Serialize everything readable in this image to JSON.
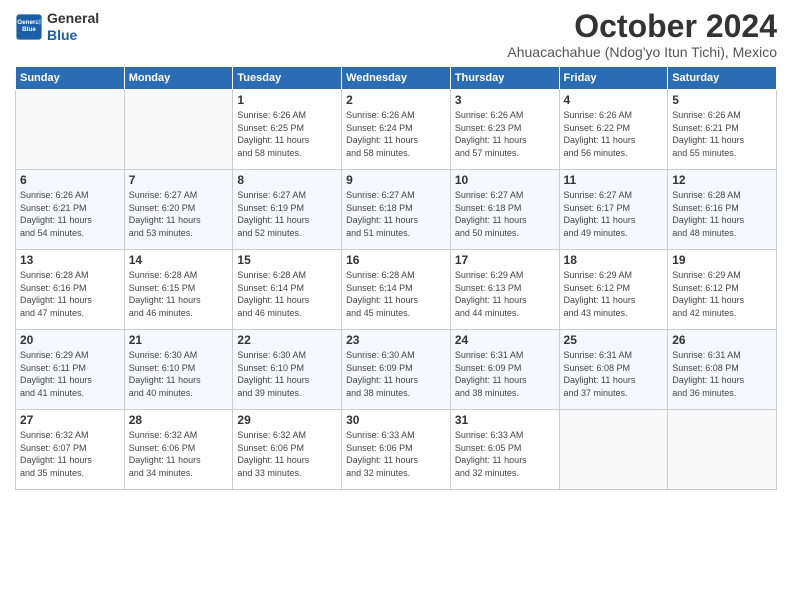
{
  "logo": {
    "line1": "General",
    "line2": "Blue"
  },
  "title": "October 2024",
  "location": "Ahuacachahue (Ndog'yo Itun Tichi), Mexico",
  "days_of_week": [
    "Sunday",
    "Monday",
    "Tuesday",
    "Wednesday",
    "Thursday",
    "Friday",
    "Saturday"
  ],
  "weeks": [
    [
      {
        "day": "",
        "info": ""
      },
      {
        "day": "",
        "info": ""
      },
      {
        "day": "1",
        "info": "Sunrise: 6:26 AM\nSunset: 6:25 PM\nDaylight: 11 hours\nand 58 minutes."
      },
      {
        "day": "2",
        "info": "Sunrise: 6:26 AM\nSunset: 6:24 PM\nDaylight: 11 hours\nand 58 minutes."
      },
      {
        "day": "3",
        "info": "Sunrise: 6:26 AM\nSunset: 6:23 PM\nDaylight: 11 hours\nand 57 minutes."
      },
      {
        "day": "4",
        "info": "Sunrise: 6:26 AM\nSunset: 6:22 PM\nDaylight: 11 hours\nand 56 minutes."
      },
      {
        "day": "5",
        "info": "Sunrise: 6:26 AM\nSunset: 6:21 PM\nDaylight: 11 hours\nand 55 minutes."
      }
    ],
    [
      {
        "day": "6",
        "info": "Sunrise: 6:26 AM\nSunset: 6:21 PM\nDaylight: 11 hours\nand 54 minutes."
      },
      {
        "day": "7",
        "info": "Sunrise: 6:27 AM\nSunset: 6:20 PM\nDaylight: 11 hours\nand 53 minutes."
      },
      {
        "day": "8",
        "info": "Sunrise: 6:27 AM\nSunset: 6:19 PM\nDaylight: 11 hours\nand 52 minutes."
      },
      {
        "day": "9",
        "info": "Sunrise: 6:27 AM\nSunset: 6:18 PM\nDaylight: 11 hours\nand 51 minutes."
      },
      {
        "day": "10",
        "info": "Sunrise: 6:27 AM\nSunset: 6:18 PM\nDaylight: 11 hours\nand 50 minutes."
      },
      {
        "day": "11",
        "info": "Sunrise: 6:27 AM\nSunset: 6:17 PM\nDaylight: 11 hours\nand 49 minutes."
      },
      {
        "day": "12",
        "info": "Sunrise: 6:28 AM\nSunset: 6:16 PM\nDaylight: 11 hours\nand 48 minutes."
      }
    ],
    [
      {
        "day": "13",
        "info": "Sunrise: 6:28 AM\nSunset: 6:16 PM\nDaylight: 11 hours\nand 47 minutes."
      },
      {
        "day": "14",
        "info": "Sunrise: 6:28 AM\nSunset: 6:15 PM\nDaylight: 11 hours\nand 46 minutes."
      },
      {
        "day": "15",
        "info": "Sunrise: 6:28 AM\nSunset: 6:14 PM\nDaylight: 11 hours\nand 46 minutes."
      },
      {
        "day": "16",
        "info": "Sunrise: 6:28 AM\nSunset: 6:14 PM\nDaylight: 11 hours\nand 45 minutes."
      },
      {
        "day": "17",
        "info": "Sunrise: 6:29 AM\nSunset: 6:13 PM\nDaylight: 11 hours\nand 44 minutes."
      },
      {
        "day": "18",
        "info": "Sunrise: 6:29 AM\nSunset: 6:12 PM\nDaylight: 11 hours\nand 43 minutes."
      },
      {
        "day": "19",
        "info": "Sunrise: 6:29 AM\nSunset: 6:12 PM\nDaylight: 11 hours\nand 42 minutes."
      }
    ],
    [
      {
        "day": "20",
        "info": "Sunrise: 6:29 AM\nSunset: 6:11 PM\nDaylight: 11 hours\nand 41 minutes."
      },
      {
        "day": "21",
        "info": "Sunrise: 6:30 AM\nSunset: 6:10 PM\nDaylight: 11 hours\nand 40 minutes."
      },
      {
        "day": "22",
        "info": "Sunrise: 6:30 AM\nSunset: 6:10 PM\nDaylight: 11 hours\nand 39 minutes."
      },
      {
        "day": "23",
        "info": "Sunrise: 6:30 AM\nSunset: 6:09 PM\nDaylight: 11 hours\nand 38 minutes."
      },
      {
        "day": "24",
        "info": "Sunrise: 6:31 AM\nSunset: 6:09 PM\nDaylight: 11 hours\nand 38 minutes."
      },
      {
        "day": "25",
        "info": "Sunrise: 6:31 AM\nSunset: 6:08 PM\nDaylight: 11 hours\nand 37 minutes."
      },
      {
        "day": "26",
        "info": "Sunrise: 6:31 AM\nSunset: 6:08 PM\nDaylight: 11 hours\nand 36 minutes."
      }
    ],
    [
      {
        "day": "27",
        "info": "Sunrise: 6:32 AM\nSunset: 6:07 PM\nDaylight: 11 hours\nand 35 minutes."
      },
      {
        "day": "28",
        "info": "Sunrise: 6:32 AM\nSunset: 6:06 PM\nDaylight: 11 hours\nand 34 minutes."
      },
      {
        "day": "29",
        "info": "Sunrise: 6:32 AM\nSunset: 6:06 PM\nDaylight: 11 hours\nand 33 minutes."
      },
      {
        "day": "30",
        "info": "Sunrise: 6:33 AM\nSunset: 6:06 PM\nDaylight: 11 hours\nand 32 minutes."
      },
      {
        "day": "31",
        "info": "Sunrise: 6:33 AM\nSunset: 6:05 PM\nDaylight: 11 hours\nand 32 minutes."
      },
      {
        "day": "",
        "info": ""
      },
      {
        "day": "",
        "info": ""
      }
    ]
  ]
}
